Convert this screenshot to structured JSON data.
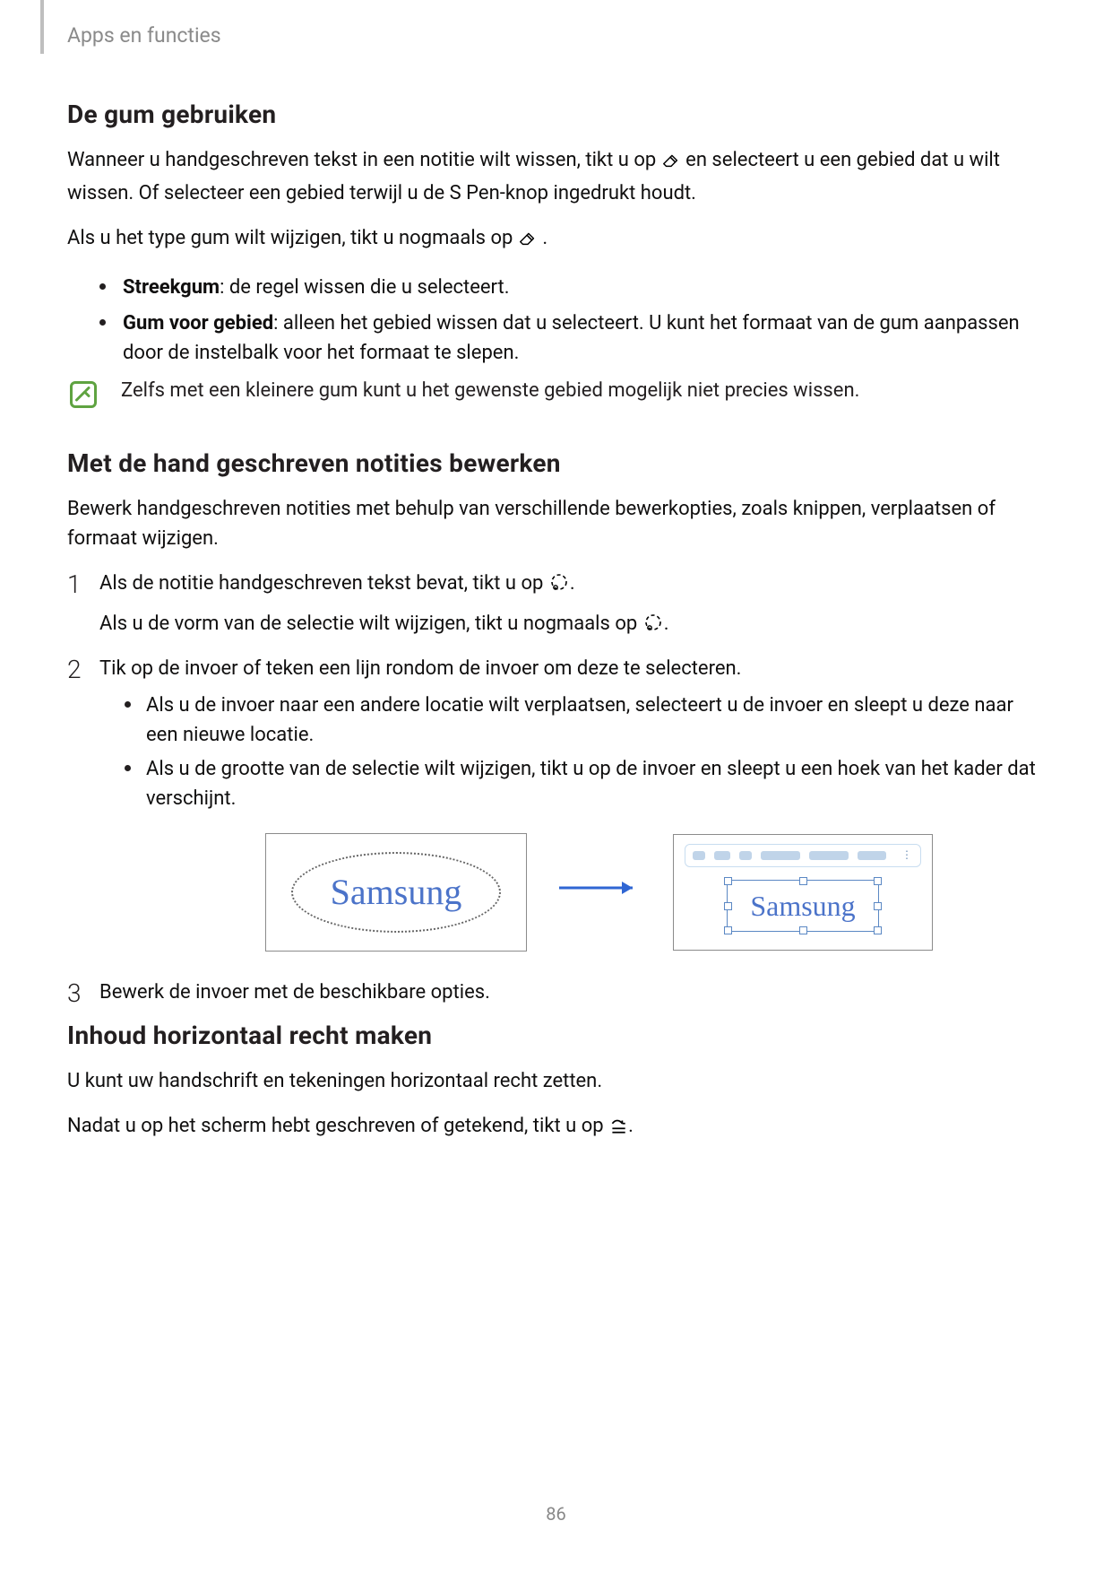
{
  "header": {
    "section_label": "Apps en functies"
  },
  "s1": {
    "heading": "De gum gebruiken",
    "p1a": "Wanneer u handgeschreven tekst in een notitie wilt wissen, tikt u op ",
    "p1b": " en selecteert u een gebied dat u wilt wissen. Of selecteer een gebied terwijl u de S Pen-knop ingedrukt houdt.",
    "p2a": "Als u het type gum wilt wijzigen, tikt u nogmaals op ",
    "p2b": ".",
    "b1_strong": "Streekgum",
    "b1_rest": ": de regel wissen die u selecteert.",
    "b2_strong": "Gum voor gebied",
    "b2_rest": ": alleen het gebied wissen dat u selecteert. U kunt het formaat van de gum aanpassen door de instelbalk voor het formaat te slepen.",
    "note": "Zelfs met een kleinere gum kunt u het gewenste gebied mogelijk niet precies wissen."
  },
  "s2": {
    "heading": "Met de hand geschreven notities bewerken",
    "p1": "Bewerk handgeschreven notities met behulp van verschillende bewerkopties, zoals knippen, verplaatsen of formaat wijzigen.",
    "step1_a": "Als de notitie handgeschreven tekst bevat, tikt u op ",
    "step1_b": ".",
    "step1_c": "Als u de vorm van de selectie wilt wijzigen, tikt u nogmaals op ",
    "step1_d": ".",
    "step2": "Tik op de invoer of teken een lijn rondom de invoer om deze te selecteren.",
    "step2_sub1": "Als u de invoer naar een andere locatie wilt verplaatsen, selecteert u de invoer en sleept u deze naar een nieuwe locatie.",
    "step2_sub2": "Als u de grootte van de selectie wilt wijzigen, tikt u op de invoer en sleept u een hoek van het kader dat verschijnt.",
    "step3": "Bewerk de invoer met de beschikbare opties."
  },
  "ill": {
    "hw1": "Samsung",
    "hw2": "Samsung"
  },
  "s3": {
    "heading": "Inhoud horizontaal recht maken",
    "p1": "U kunt uw handschrift en tekeningen horizontaal recht zetten.",
    "p2a": "Nadat u op het scherm hebt geschreven of getekend, tikt u op ",
    "p2b": "."
  },
  "footer": {
    "page_number": "86"
  }
}
